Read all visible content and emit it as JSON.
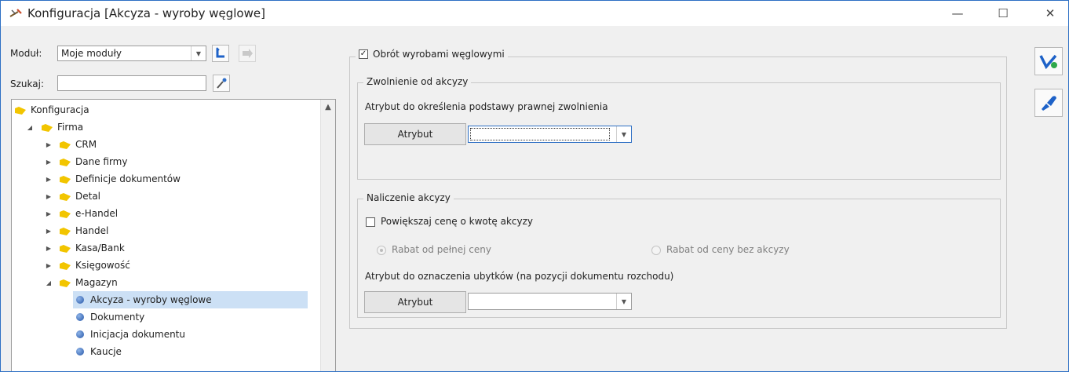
{
  "window": {
    "title": "Konfiguracja [Akcyza - wyroby węglowe]",
    "minimize": "—",
    "maximize": "☐",
    "close": "✕"
  },
  "module": {
    "label": "Moduł:",
    "value": "Moje moduły"
  },
  "search": {
    "label": "Szukaj:",
    "value": ""
  },
  "tree": {
    "items": [
      {
        "label": "Konfiguracja"
      },
      {
        "label": "Firma"
      },
      {
        "label": "CRM"
      },
      {
        "label": "Dane firmy"
      },
      {
        "label": "Definicje dokumentów"
      },
      {
        "label": "Detal"
      },
      {
        "label": "e-Handel"
      },
      {
        "label": "Handel"
      },
      {
        "label": "Kasa/Bank"
      },
      {
        "label": "Księgowość"
      },
      {
        "label": "Magazyn"
      },
      {
        "label": "Akcyza - wyroby węglowe"
      },
      {
        "label": "Dokumenty"
      },
      {
        "label": "Inicjacja dokumentu"
      },
      {
        "label": "Kaucje"
      }
    ]
  },
  "main": {
    "obrot_label": "Obrót wyrobami węglowymi",
    "obrot_checked": true,
    "zwolnienie": {
      "title": "Zwolnienie od akcyzy",
      "desc": "Atrybut do określenia podstawy prawnej zwolnienia",
      "button": "Atrybut",
      "value": ""
    },
    "naliczenie": {
      "title": "Naliczenie akcyzy",
      "checkbox_label": "Powiększaj cenę o kwotę akcyzy",
      "checkbox_checked": false,
      "radio1": "Rabat od pełnej ceny",
      "radio2": "Rabat od ceny bez akcyzy",
      "desc": "Atrybut do oznaczenia ubytków (na pozycji dokumentu rozchodu)",
      "button": "Atrybut",
      "value": ""
    }
  },
  "colors": {
    "accent": "#2d6fc4",
    "folder": "#f2c500",
    "selection": "#cce0f5"
  }
}
